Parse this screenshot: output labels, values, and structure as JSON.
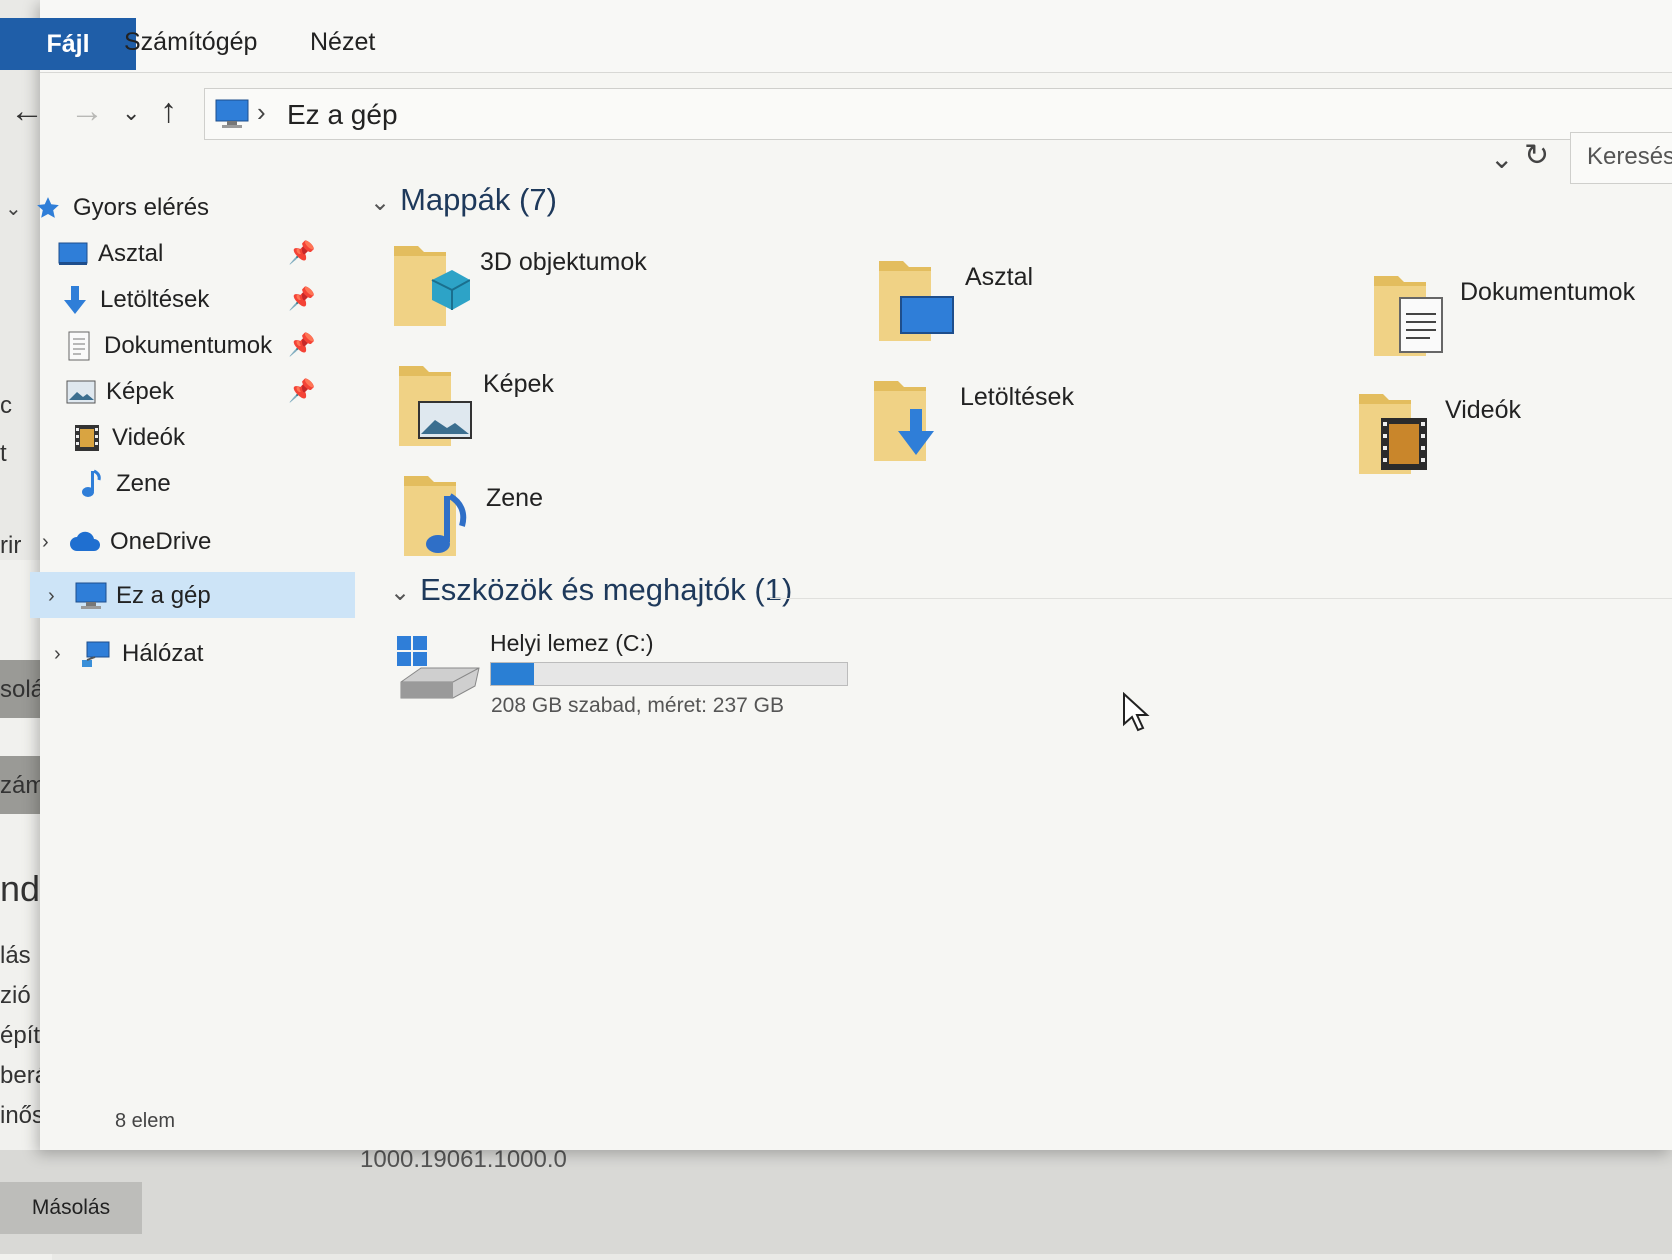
{
  "ribbon": {
    "tabs": [
      "Fájl",
      "Számítógép",
      "Nézet"
    ]
  },
  "address": {
    "path": "Ez a gép",
    "search_placeholder": "Keresés"
  },
  "sidebar": {
    "quick_access": "Gyors elérés",
    "quick_items": [
      "Asztal",
      "Letöltések",
      "Dokumentumok",
      "Képek",
      "Videók",
      "Zene"
    ],
    "onedrive": "OneDrive",
    "this_pc": "Ez a gép",
    "network": "Hálózat"
  },
  "content": {
    "folders_header": "Mappák (7)",
    "folders": [
      "3D objektumok",
      "Asztal",
      "Dokumentumok",
      "Képek",
      "Letöltések",
      "Videók",
      "Zene"
    ],
    "devices_header": "Eszközök és meghajtók (1)",
    "drive": {
      "name": "Helyi lemez (C:)",
      "info": "208 GB szabad, méret: 237 GB",
      "used_fraction": 0.12
    }
  },
  "status": {
    "count": "8 elem"
  },
  "background": {
    "texts": [
      "c",
      "t",
      "rir",
      "solá",
      "zámí",
      "ndov",
      "lás",
      "zió",
      "építés c",
      "berációs",
      "inőség"
    ],
    "copy_button": "Másolás",
    "version": "1000.19061.1000.0"
  },
  "colors": {
    "accent": "#1f5ea8",
    "selection": "#cde4f7",
    "folder": "#e8c66a",
    "drive_fill": "#2a7fd4"
  }
}
